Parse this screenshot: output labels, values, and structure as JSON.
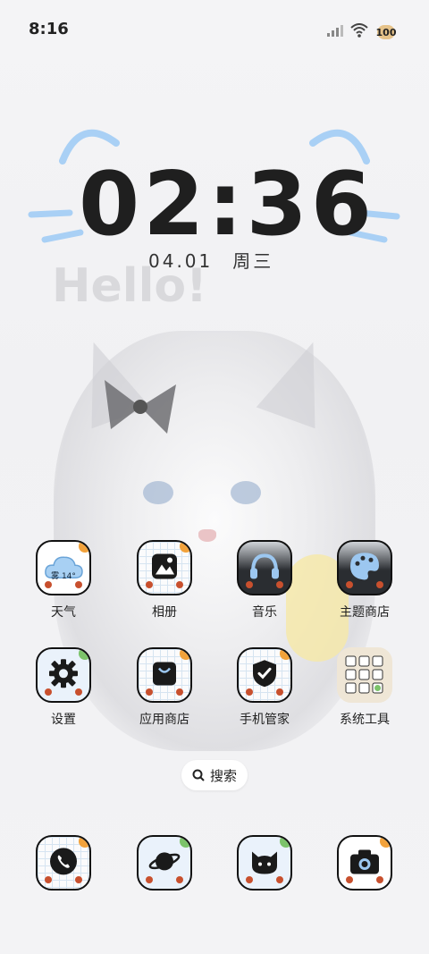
{
  "status_bar": {
    "time": "8:16",
    "battery": "100"
  },
  "clock": {
    "time": "02:36",
    "date": "04.01",
    "weekday": "周三"
  },
  "wallpaper": {
    "hello_text": "Hello!"
  },
  "apps_row1": [
    {
      "label": "天气",
      "badge": "雾 14°",
      "icon": "weather-cloud-icon"
    },
    {
      "label": "相册",
      "icon": "gallery-icon"
    },
    {
      "label": "音乐",
      "icon": "headphones-icon"
    },
    {
      "label": "主题商店",
      "icon": "palette-icon"
    }
  ],
  "apps_row2": [
    {
      "label": "设置",
      "icon": "gear-icon"
    },
    {
      "label": "应用商店",
      "icon": "shopping-bag-icon"
    },
    {
      "label": "手机管家",
      "icon": "shield-check-icon"
    },
    {
      "label": "系统工具",
      "icon": "folder-icon"
    }
  ],
  "search": {
    "label": "搜索"
  },
  "dock": [
    {
      "icon": "phone-icon"
    },
    {
      "icon": "planet-icon"
    },
    {
      "icon": "cat-face-icon"
    },
    {
      "icon": "camera-icon"
    }
  ],
  "colors": {
    "accent_blue": "#9cc7f0",
    "dot_red": "#c8502e",
    "icon_border": "#111111"
  }
}
